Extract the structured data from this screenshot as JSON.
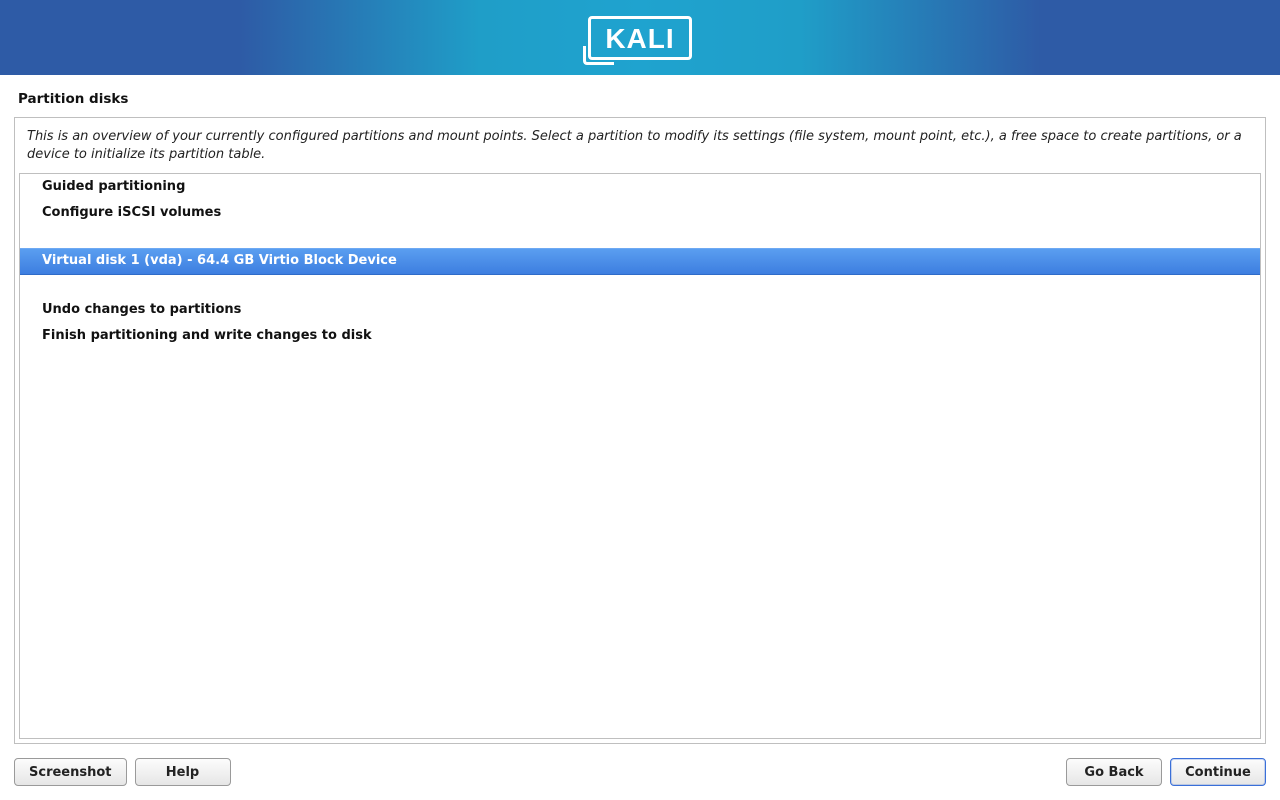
{
  "header": {
    "logo_text": "KALI"
  },
  "title": "Partition disks",
  "instructions": "This is an overview of your currently configured partitions and mount points. Select a partition to modify its settings (file system, mount point, etc.), a free space to create partitions, or a device to initialize its partition table.",
  "list": {
    "guided": "Guided partitioning",
    "iscsi": "Configure iSCSI volumes",
    "disk": "Virtual disk 1 (vda) - 64.4 GB Virtio Block Device",
    "undo": "Undo changes to partitions",
    "finish": "Finish partitioning and write changes to disk"
  },
  "buttons": {
    "screenshot": "Screenshot",
    "help": "Help",
    "goback": "Go Back",
    "continue": "Continue"
  }
}
